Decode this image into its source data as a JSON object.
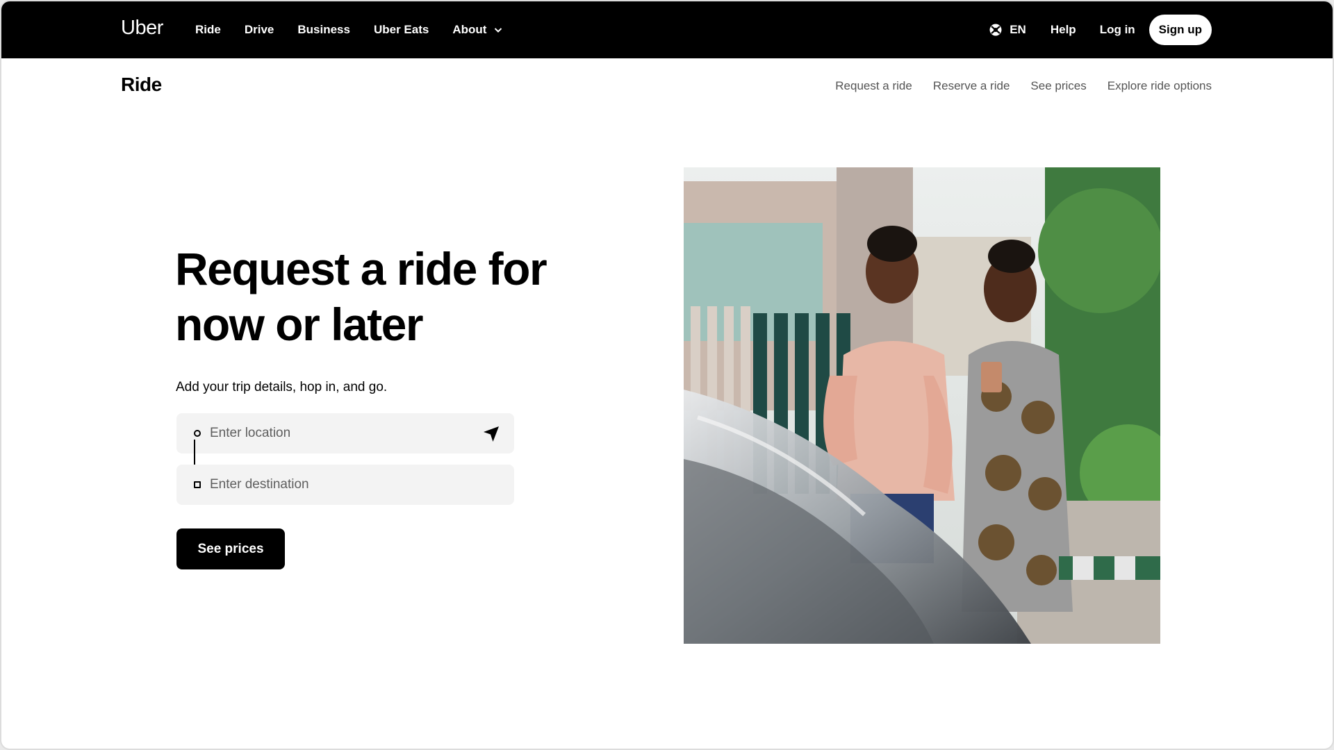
{
  "topnav": {
    "logo": "Uber",
    "links": [
      "Ride",
      "Drive",
      "Business",
      "Uber Eats",
      "About"
    ],
    "language": "EN",
    "help": "Help",
    "login": "Log in",
    "signup": "Sign up"
  },
  "subnav": {
    "title": "Ride",
    "links": [
      "Request a ride",
      "Reserve a ride",
      "See prices",
      "Explore ride options"
    ]
  },
  "hero": {
    "title_line1": "Request a ride for",
    "title_line2": "now or later",
    "subtitle": "Add your trip details, hop in, and go.",
    "location_placeholder": "Enter location",
    "destination_placeholder": "Enter destination",
    "cta": "See prices"
  },
  "icons": {
    "globe": "globe-icon",
    "chevron": "chevron-down-icon",
    "arrow": "navigation-arrow-icon"
  },
  "colors": {
    "nav_bg": "#000000",
    "field_bg": "#f3f3f3",
    "subnav_link": "#545454"
  }
}
